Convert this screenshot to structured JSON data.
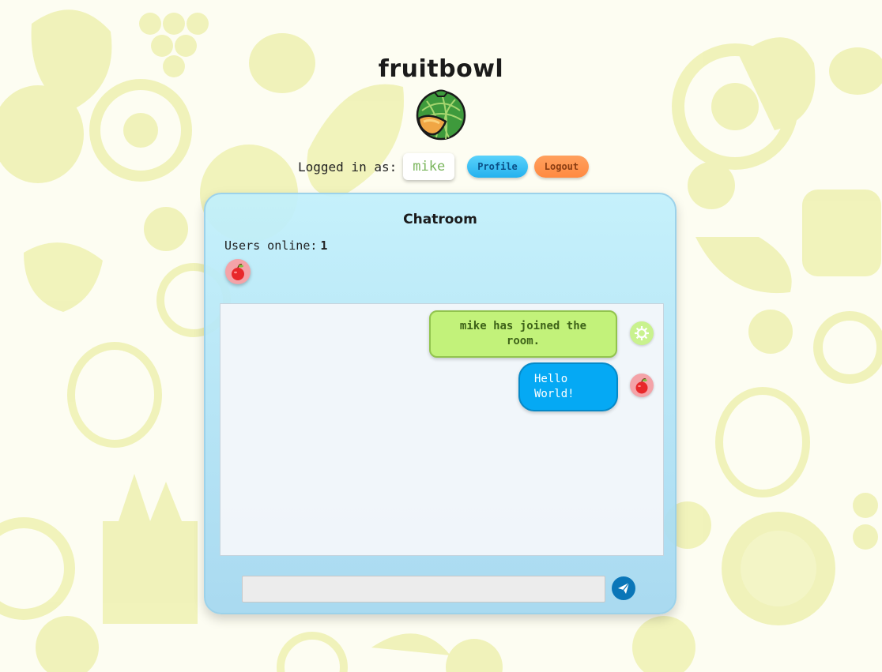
{
  "header": {
    "title": "fruitbowl",
    "logo": "melon-logo-icon"
  },
  "session": {
    "logged_in_label": "Logged in as:",
    "username": "mike",
    "profile_label": "Profile",
    "logout_label": "Logout"
  },
  "chatroom": {
    "title": "Chatroom",
    "users_online_label": "Users online:",
    "users_online_count": "1",
    "online_users": [
      {
        "avatar": "apple-avatar-icon"
      }
    ],
    "messages": [
      {
        "type": "system",
        "text": "mike has joined the room.",
        "avatar": "gear-avatar-icon"
      },
      {
        "type": "user",
        "text": "Hello World!",
        "avatar": "apple-avatar-icon"
      }
    ],
    "input_value": "",
    "send_icon": "paper-plane-icon"
  },
  "colors": {
    "background": "#fdfdf2",
    "panel": "#c1f0fc",
    "system_bubble": "#c2f27a",
    "user_bubble": "#05a9f4",
    "profile_button": "#23b1ee",
    "logout_button": "#ff8a42",
    "send_button": "#0a76b8"
  }
}
